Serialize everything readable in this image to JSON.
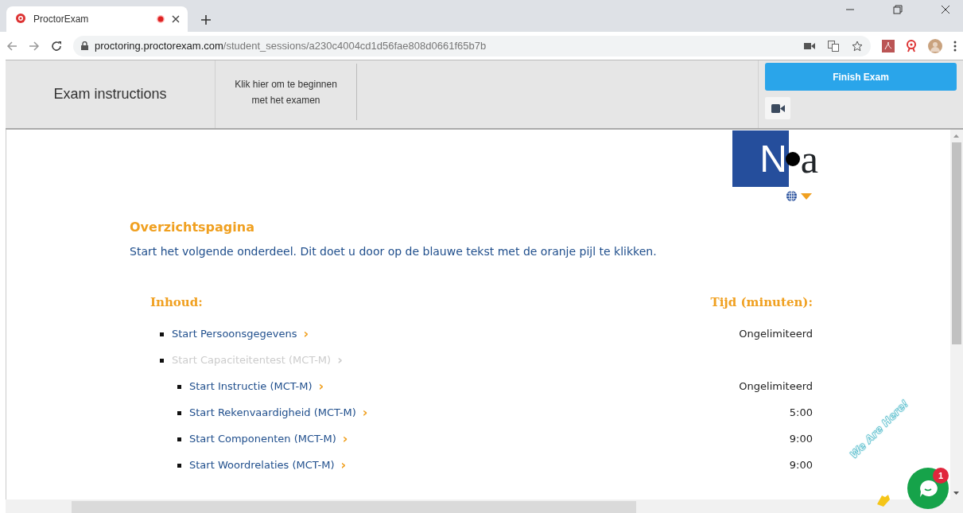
{
  "browser": {
    "tab": {
      "title": "ProctorExam",
      "recording": true
    },
    "url": {
      "host": "proctoring.proctorexam.com",
      "path": "/student_sessions/a230c4004cd1d56fae808d0661f65b7b"
    }
  },
  "header": {
    "title": "Exam instructions",
    "start_link": "Klik hier om te beginnen met het examen",
    "finish_button": "Finish Exam"
  },
  "logo": {
    "letters": [
      "N",
      "a"
    ]
  },
  "page": {
    "heading": "Overzichtspagina",
    "intro": "Start het volgende onderdeel. Dit doet u door op de blauwe tekst met de oranje pijl te klikken.",
    "col_content": "Inhoud:",
    "col_time": "Tijd (minuten):",
    "items": [
      {
        "label": "Start Persoonsgegevens",
        "arrow": "›",
        "time": "Ongelimiteerd",
        "disabled": false
      },
      {
        "label": "Start Capaciteitentest (MCT-M)",
        "arrow": "›",
        "disabled": true,
        "children": [
          {
            "label": "Start Instructie (MCT-M)",
            "arrow": "›",
            "time": "Ongelimiteerd",
            "disabled": false
          },
          {
            "label": "Start Rekenvaardigheid (MCT-M)",
            "arrow": "›",
            "time": "5:00",
            "disabled": false
          },
          {
            "label": "Start Componenten (MCT-M)",
            "arrow": "›",
            "time": "9:00",
            "disabled": false
          },
          {
            "label": "Start Woordrelaties (MCT-M)",
            "arrow": "›",
            "time": "9:00",
            "disabled": false
          }
        ]
      }
    ]
  },
  "chat": {
    "banner": "We Are Here!",
    "badge": "1"
  }
}
